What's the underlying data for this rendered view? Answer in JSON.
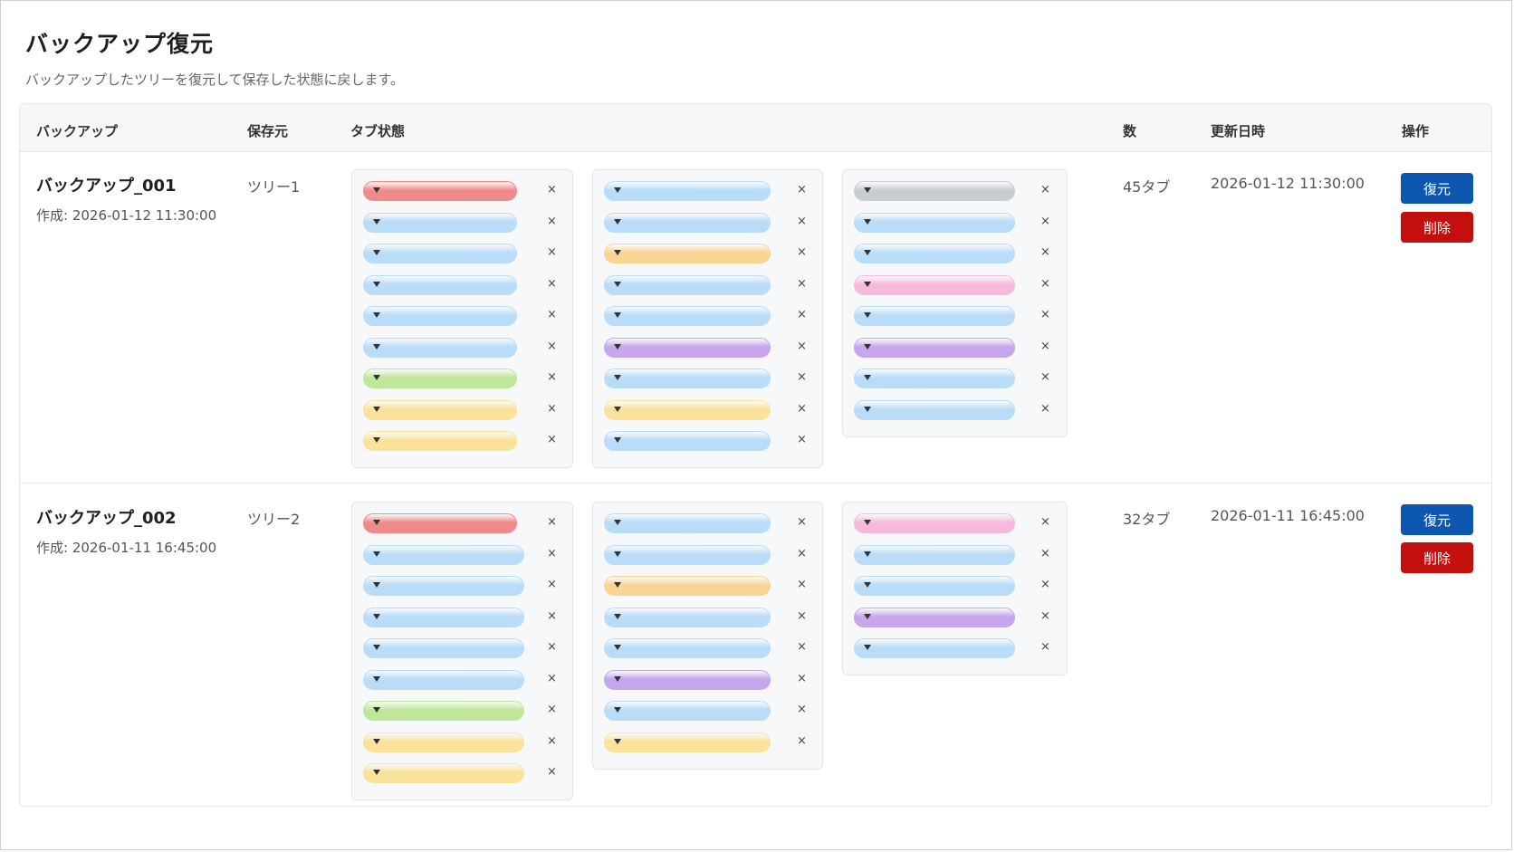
{
  "page": {
    "title": "バックアップ復元",
    "subtitle": "バックアップしたツリーを復元して保存した状態に戻します。"
  },
  "table": {
    "headers": {
      "backup": "バックアップ",
      "source": "保存元",
      "tabs": "タブ状態",
      "count": "数",
      "updated": "更新日時",
      "actions": "操作"
    }
  },
  "colors": {
    "red": "#f08a8a",
    "blue": "#b9dcf8",
    "green": "#bfe79a",
    "yellow": "#fbe29a",
    "orange": "#fbd494",
    "purple": "#c6a6ec",
    "pink": "#f6b9dc",
    "gray": "#c9cdd2"
  },
  "close_glyph": "×",
  "rows": [
    {
      "name": "バックアップ_001",
      "created": "作成: 2026-01-12 11:30:00",
      "source": "ツリー1",
      "count": "45タブ",
      "updated": "2026-01-12 11:30:00",
      "restore_label": "復元",
      "delete_label": "削除",
      "groups": [
        [
          "red",
          "blue",
          "blue",
          "blue",
          "blue",
          "blue",
          "green",
          "yellow",
          "yellow"
        ],
        [
          "blue",
          "blue",
          "orange",
          "blue",
          "blue",
          "purple",
          "blue",
          "yellow",
          "blue"
        ],
        [
          "gray",
          "blue",
          "blue",
          "pink",
          "blue",
          "purple",
          "blue",
          "blue"
        ]
      ]
    },
    {
      "name": "バックアップ_002",
      "created": "作成: 2026-01-11 16:45:00",
      "source": "ツリー2",
      "count": "32タブ",
      "updated": "2026-01-11 16:45:00",
      "restore_label": "復元",
      "delete_label": "削除",
      "groups": [
        [
          "red",
          "blue",
          "blue",
          "blue",
          "blue",
          "blue",
          "green",
          "yellow",
          "yellow"
        ],
        [
          "blue",
          "blue",
          "orange",
          "blue",
          "blue",
          "purple",
          "blue",
          "yellow"
        ],
        [
          "pink",
          "blue",
          "blue",
          "purple",
          "blue"
        ]
      ]
    }
  ]
}
